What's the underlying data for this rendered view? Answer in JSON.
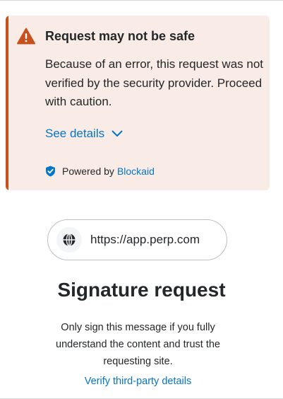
{
  "alert": {
    "title": "Request may not be safe",
    "body": "Because of an error, this request was not verified by the security provider. Proceed with caution.",
    "see_details_label": "See details",
    "powered_prefix": "Powered by",
    "powered_brand": "Blockaid",
    "icon": "warning-icon",
    "accent_color": "#c6511c",
    "background_color": "#f9ebe5"
  },
  "origin": {
    "url": "https://app.perp.com",
    "icon": "globe-icon"
  },
  "page": {
    "title": "Signature request",
    "subtitle": "Only sign this message if you fully understand the content and trust the requesting site.",
    "verify_link": "Verify third-party details"
  },
  "colors": {
    "link": "#0376c9",
    "text": "#24272a"
  }
}
